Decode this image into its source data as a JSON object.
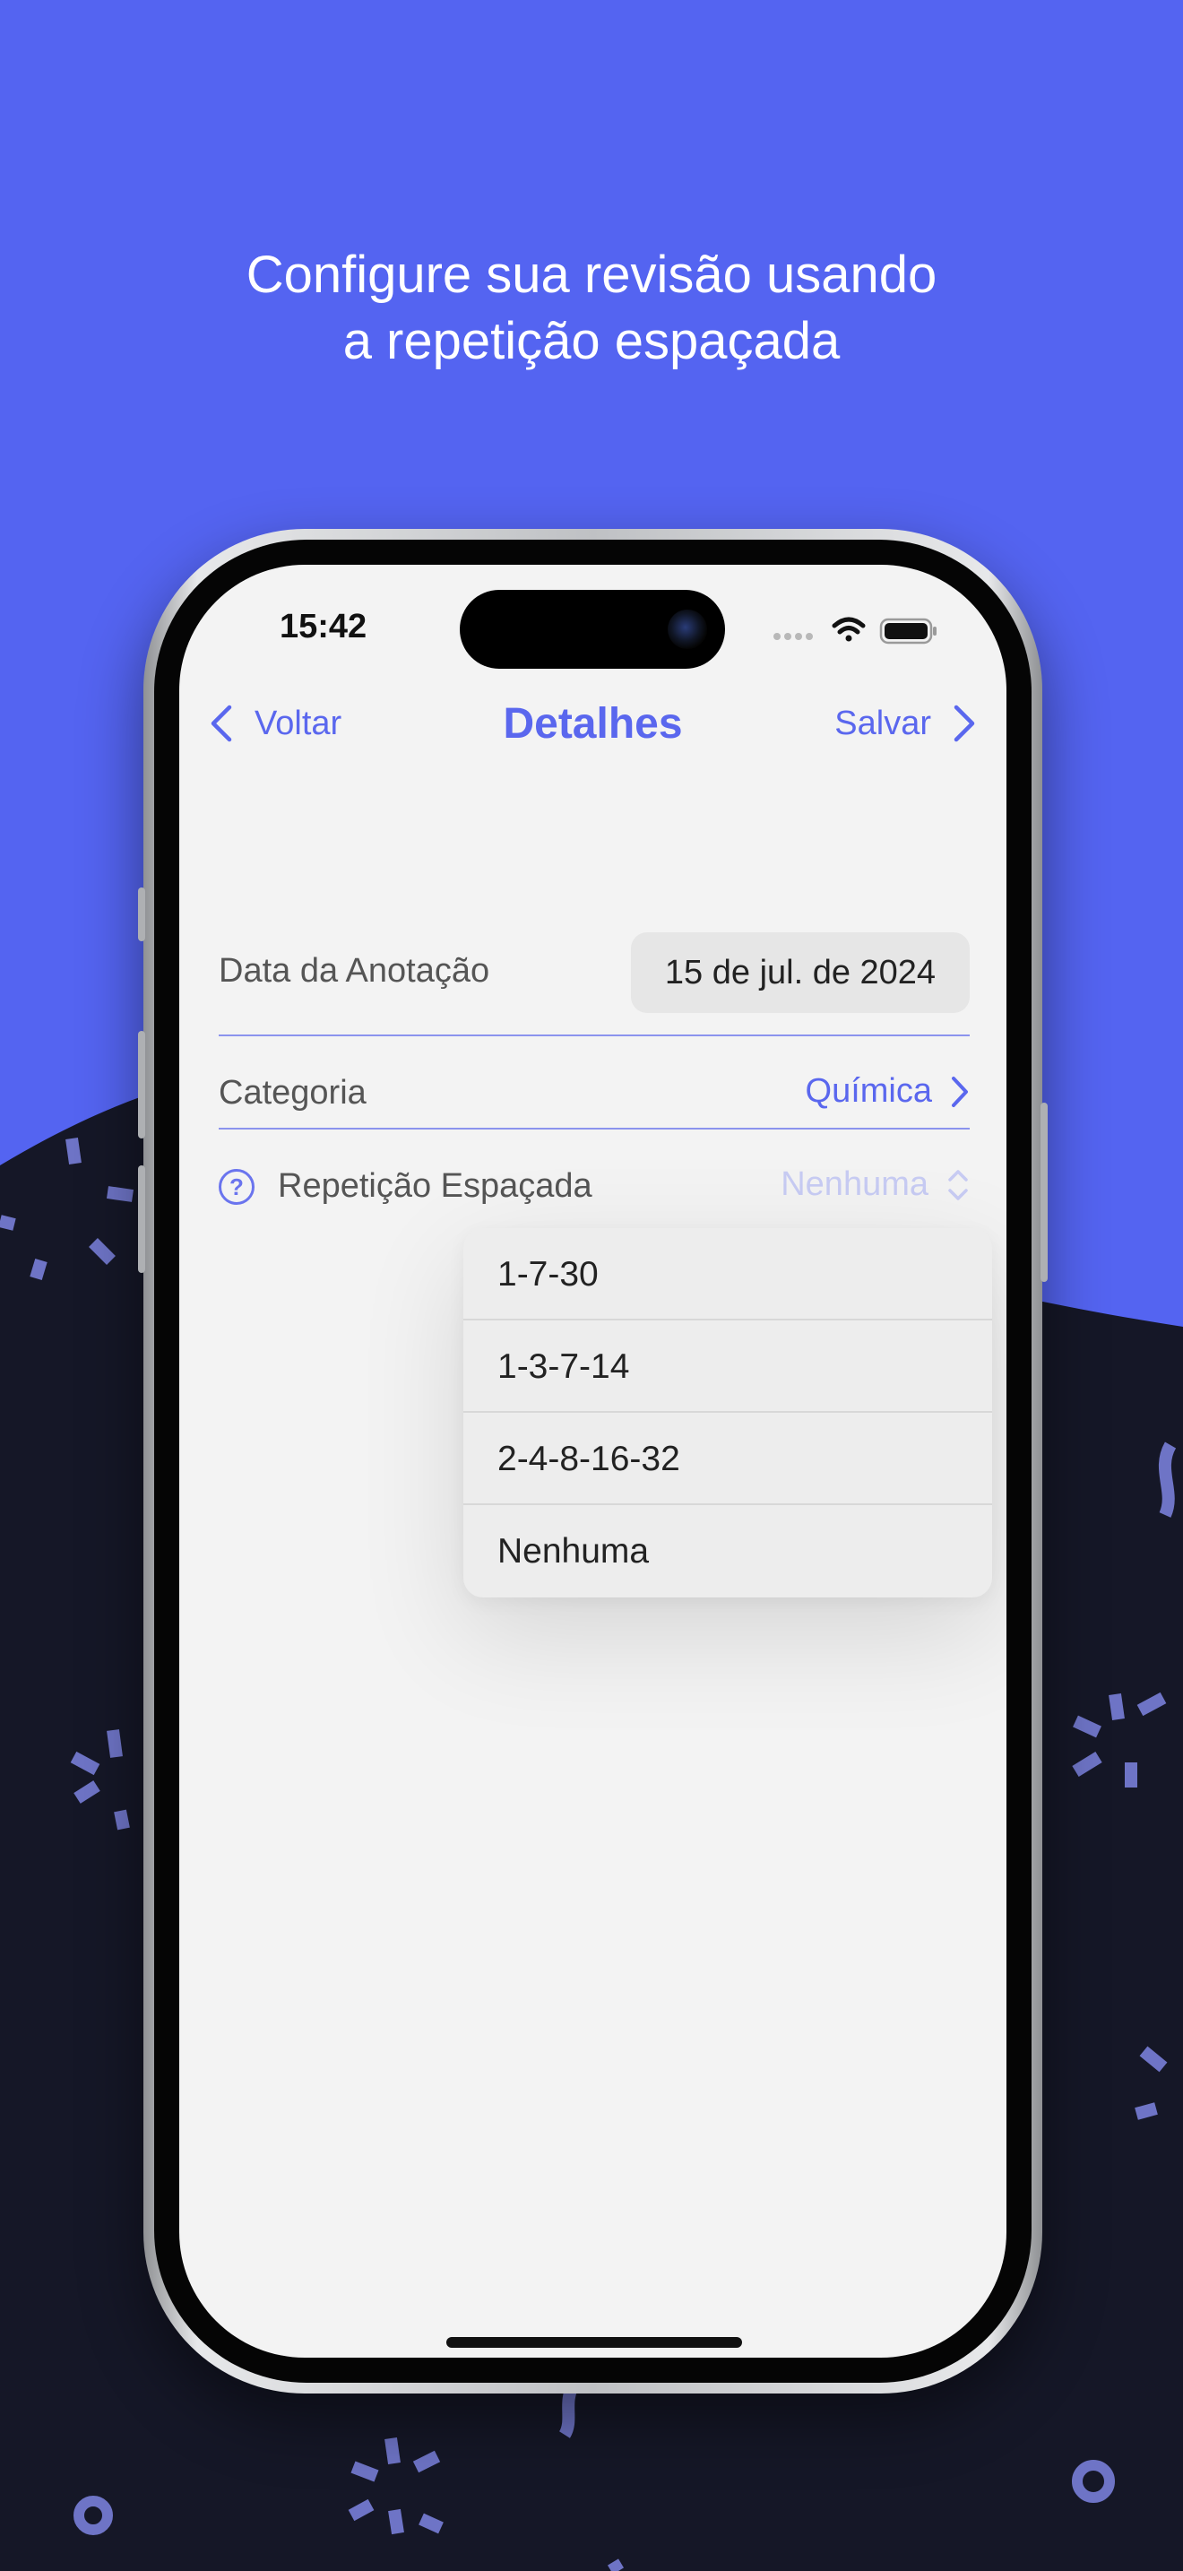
{
  "headline": {
    "line1": "Configure sua revisão usando",
    "line2": "a repetição espaçada"
  },
  "colors": {
    "background_top": "#5464F1",
    "background_bottom": "#151727",
    "accent": "#5A67EE",
    "confetti": "#6E74C6"
  },
  "status_bar": {
    "time": "15:42",
    "icons": [
      "signal-dots-icon",
      "wifi-icon",
      "battery-icon"
    ]
  },
  "nav": {
    "back_label": "Voltar",
    "title": "Detalhes",
    "save_label": "Salvar"
  },
  "form": {
    "date_label": "Data da Anotação",
    "date_value": "15 de jul. de 2024",
    "category_label": "Categoria",
    "category_value": "Química",
    "repetition_label": "Repetição Espaçada",
    "repetition_value": "Nenhuma"
  },
  "menu": {
    "options": [
      "1-7-30",
      "1-3-7-14",
      "2-4-8-16-32",
      "Nenhuma"
    ]
  }
}
